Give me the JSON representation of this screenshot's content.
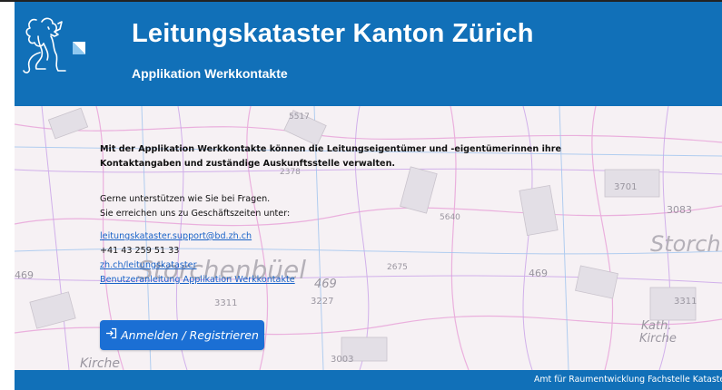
{
  "header": {
    "title": "Leitungskataster Kanton Zürich",
    "subtitle": "Applikation Werkkontakte"
  },
  "content": {
    "intro_line1": "Mit der Applikation Werkkontakte können die Leitungseigentümer und -eigentümerinnen ihre",
    "intro_line2": "Kontaktangaben und zuständige Auskunftsstelle verwalten.",
    "help_line1": "Gerne unterstützen wie Sie bei Fragen.",
    "help_line2": "Sie erreichen uns zu Geschäftszeiten unter:",
    "email": "leitungskataster.support@bd.zh.ch",
    "phone": "+41 43 259 51 33",
    "website": "zh.ch/leitungskataster",
    "manual_link": "Benutzeranleitung Applikation Werkkontakte"
  },
  "login_button": {
    "icon": "login-icon",
    "label": "Anmelden / Registrieren"
  },
  "map_labels": {
    "place1": "Storchenbüel",
    "place2": "Storch",
    "place3": "Kath.",
    "place4": "Kirche",
    "place5": "Kirche",
    "n1": "469",
    "n2": "3227",
    "n3": "3311",
    "n4": "3083",
    "n5": "469",
    "n6": "3003",
    "n7": "3311",
    "n8": "469",
    "n9": "3701",
    "n10": "5517",
    "n11": "2378",
    "n12": "5640",
    "n13": "2675"
  },
  "footer": {
    "text": "Amt für Raumentwicklung Fachstelle Kataster"
  },
  "colors": {
    "header_blue": "#1170b8",
    "button_blue": "#1b6fd4",
    "link_blue": "#1a63c8"
  }
}
